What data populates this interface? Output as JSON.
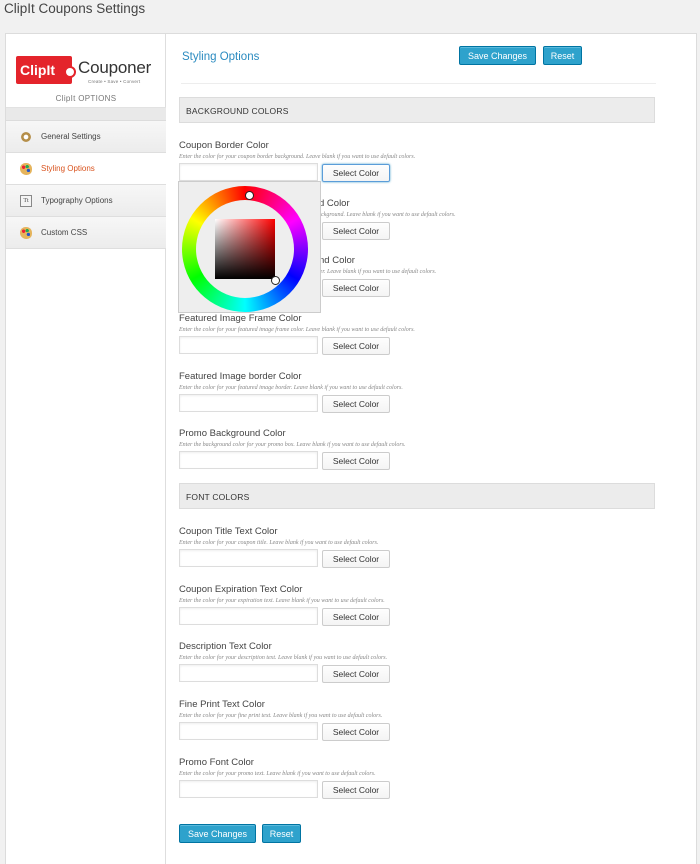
{
  "page_title": "ClipIt Coupons Settings",
  "logo": {
    "badge": "ClipIt",
    "word": "Couponer",
    "tagline": "Create • Save • Convert"
  },
  "sidebar": {
    "options_label": "ClipIt OPTIONS",
    "items": [
      {
        "label": "General Settings",
        "icon": "gear-icon",
        "active": false
      },
      {
        "label": "Styling Options",
        "icon": "palette-icon",
        "active": true
      },
      {
        "label": "Typography Options",
        "icon": "typography-icon",
        "active": false
      },
      {
        "label": "Custom CSS",
        "icon": "palette-icon",
        "active": false
      }
    ]
  },
  "main": {
    "title": "Styling Options",
    "save_label": "Save Changes",
    "reset_label": "Reset",
    "select_color_label": "Select Color",
    "sections": {
      "background": "BACKGROUND COLORS",
      "font": "FONT COLORS"
    },
    "fields": [
      {
        "label": "Coupon Border Color",
        "desc": "Enter the color for your coupon border background. Leave blank if you want to use default colors.",
        "value": ""
      },
      {
        "label": "d Color",
        "desc": "ackground. Leave blank if you want to use default colors.",
        "value": ""
      },
      {
        "label": "nd Color",
        "desc": "ter. Leave blank if you want to use default colors.",
        "value": ""
      },
      {
        "label": "Featured Image Frame Color",
        "desc": "Enter the color for your featured image frame color. Leave blank if you want to use default colors.",
        "value": ""
      },
      {
        "label": "Featured Image border Color",
        "desc": "Enter the color for your featured image border. Leave blank if you want to use default colors.",
        "value": ""
      },
      {
        "label": "Promo Background Color",
        "desc": "Enter the background color for your promo box. Leave blank if you want to use default colors.",
        "value": ""
      },
      {
        "label": "Coupon Title Text Color",
        "desc": "Enter the color for your coupon title. Leave blank if you want to use default colors.",
        "value": ""
      },
      {
        "label": "Coupon Expiration Text Color",
        "desc": "Enter the color for your expiration text. Leave blank if you want to use default colors.",
        "value": ""
      },
      {
        "label": "Description Text Color",
        "desc": "Enter the color for your description text. Leave blank if you want to use default colors.",
        "value": ""
      },
      {
        "label": "Fine Print Text Color",
        "desc": "Enter the color for your fine print text. Leave blank if you want to use default colors.",
        "value": ""
      },
      {
        "label": "Promo Font Color",
        "desc": "Enter the color for your promo text. Leave blank if you want to use default colors.",
        "value": ""
      }
    ]
  },
  "colors": {
    "accent": "#2ea2cc",
    "active_nav": "#d9531e",
    "title_blue": "#2b8bc0",
    "logo_red": "#e4242b"
  }
}
